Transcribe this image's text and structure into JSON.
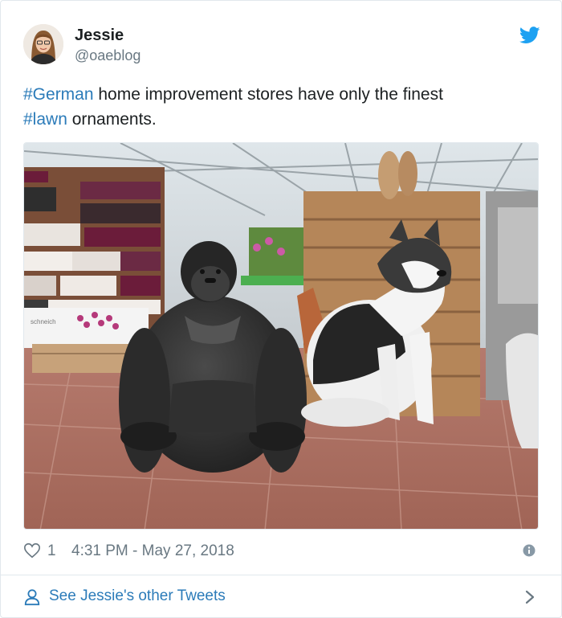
{
  "tweet": {
    "author_name": "Jessie",
    "author_handle": "@oaeblog",
    "text_segments": [
      {
        "type": "hashtag",
        "text": "#German"
      },
      {
        "type": "text",
        "text": " home improvement stores have only the finest"
      },
      {
        "type": "hashtag",
        "text": "#lawn"
      },
      {
        "type": "text",
        "text": " ornaments."
      }
    ],
    "media": {
      "icon": "photo-gorilla-husky-statues",
      "pallet_label": "schneich"
    },
    "likes_count": "1",
    "timestamp": "4:31 PM - May 27, 2018"
  },
  "footer": {
    "see_more_label": "See Jessie's other Tweets"
  },
  "icons": {
    "brand": "twitter-bird-icon",
    "like": "heart-icon",
    "info": "info-icon",
    "profile": "person-icon",
    "next": "chevron-right-icon"
  },
  "colors": {
    "link": "#2b7bb9",
    "brand": "#1da1f2",
    "muted": "#697882",
    "text": "#1c2022",
    "border": "#e1e8ed"
  }
}
